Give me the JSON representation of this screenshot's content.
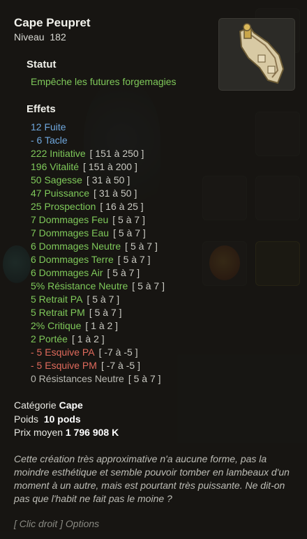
{
  "item": {
    "name": "Cape Peupret",
    "level_label": "Niveau",
    "level_value": "182",
    "icon": "cape-item-icon"
  },
  "status": {
    "title": "Statut",
    "text": "Empêche les futures forgemagies"
  },
  "effects": {
    "title": "Effets",
    "items": [
      {
        "text": "12 Fuite",
        "range": "",
        "color": "blue"
      },
      {
        "text": "- 6 Tacle",
        "range": "",
        "color": "blue"
      },
      {
        "text": "222 Initiative",
        "range": "[ 151 à 250 ]",
        "color": "green"
      },
      {
        "text": "196 Vitalité",
        "range": "[ 151 à 200 ]",
        "color": "green"
      },
      {
        "text": "50 Sagesse",
        "range": "[ 31 à 50 ]",
        "color": "green"
      },
      {
        "text": "47 Puissance",
        "range": "[ 31 à 50 ]",
        "color": "green"
      },
      {
        "text": "25 Prospection",
        "range": "[ 16 à 25 ]",
        "color": "green"
      },
      {
        "text": "7 Dommages Feu",
        "range": "[ 5 à 7 ]",
        "color": "green"
      },
      {
        "text": "7 Dommages Eau",
        "range": "[ 5 à 7 ]",
        "color": "green"
      },
      {
        "text": "6 Dommages Neutre",
        "range": "[ 5 à 7 ]",
        "color": "green"
      },
      {
        "text": "6 Dommages Terre",
        "range": "[ 5 à 7 ]",
        "color": "green"
      },
      {
        "text": "6 Dommages Air",
        "range": "[ 5 à 7 ]",
        "color": "green"
      },
      {
        "text": "5% Résistance Neutre",
        "range": "[ 5 à 7 ]",
        "color": "green"
      },
      {
        "text": "5 Retrait PA",
        "range": "[ 5 à 7 ]",
        "color": "green"
      },
      {
        "text": "5 Retrait PM",
        "range": "[ 5 à 7 ]",
        "color": "green"
      },
      {
        "text": "2% Critique",
        "range": "[ 1 à 2 ]",
        "color": "green"
      },
      {
        "text": "2 Portée",
        "range": "[ 1 à 2 ]",
        "color": "green"
      },
      {
        "text": "- 5 Esquive PA",
        "range": "[ -7 à -5 ]",
        "color": "red"
      },
      {
        "text": "- 5 Esquive PM",
        "range": "[ -7 à -5 ]",
        "color": "red"
      },
      {
        "text": "0 Résistances Neutre",
        "range": "[ 5 à 7 ]",
        "color": "gray"
      }
    ]
  },
  "info": {
    "category_label": "Catégorie",
    "category_value": "Cape",
    "weight_label": "Poids",
    "weight_value": "10 pods",
    "price_label": "Prix moyen",
    "price_value": "1 796 908 K"
  },
  "description": "Cette création très approximative n'a aucune forme, pas la moindre esthétique et semble pouvoir tomber en lambeaux d'un moment à un autre, mais est pourtant très puissante. Ne dit-on pas que l'habit ne fait pas le moine ?",
  "footer_hint": "[ Clic droit ] Options",
  "colors": {
    "blue": "#6fa7dd",
    "green": "#7fc95a",
    "red": "#e06a5c",
    "gray": "#b9b9b2"
  }
}
